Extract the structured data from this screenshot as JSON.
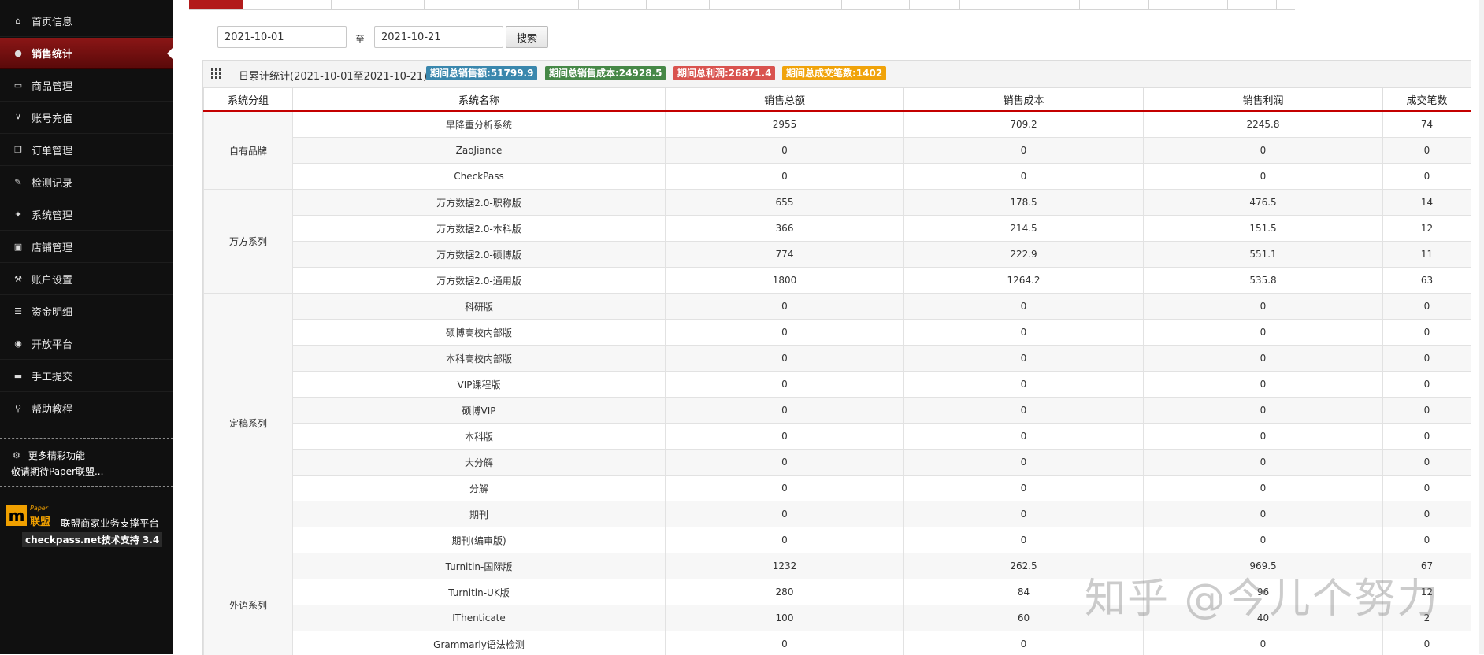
{
  "sidebar": {
    "items": [
      {
        "icon": "home-icon",
        "glyph": "⌂",
        "label": "首页信息"
      },
      {
        "icon": "user-icon",
        "glyph": "●",
        "label": "销售统计",
        "active": true
      },
      {
        "icon": "credit-card-icon",
        "glyph": "▭",
        "label": "商品管理"
      },
      {
        "icon": "cart-icon",
        "glyph": "⊻",
        "label": "账号充值"
      },
      {
        "icon": "copy-icon",
        "glyph": "❐",
        "label": "订单管理"
      },
      {
        "icon": "edit-icon",
        "glyph": "✎",
        "label": "检测记录"
      },
      {
        "icon": "wrench-icon",
        "glyph": "✦",
        "label": "系统管理"
      },
      {
        "icon": "truck-icon",
        "glyph": "▣",
        "label": "店铺管理"
      },
      {
        "icon": "hammer-icon",
        "glyph": "⚒",
        "label": "账户设置"
      },
      {
        "icon": "list-icon",
        "glyph": "☰",
        "label": "资金明细"
      },
      {
        "icon": "globe-icon",
        "glyph": "◉",
        "label": "开放平台"
      },
      {
        "icon": "folder-icon",
        "glyph": "▬",
        "label": "手工提交"
      },
      {
        "icon": "search-icon",
        "glyph": "⚲",
        "label": "帮助教程"
      }
    ],
    "more": {
      "line1": "更多精彩功能",
      "line2": "敬请期待Paper联盟..."
    },
    "brand": {
      "logo_m": "m",
      "logo_paper": "Paper",
      "logo_lm": "联盟",
      "title": "联盟商家业务支撑平台",
      "sub": "checkpass.net技术支持 3.4"
    }
  },
  "search": {
    "start_date": "2021-10-01",
    "to_label": "至",
    "end_date": "2021-10-21",
    "button": "搜索"
  },
  "stats": {
    "title": "日累计统计(2021-10-01至2021-10-21)",
    "badges": [
      {
        "text": "期间总销售额:51799.9",
        "color": "#3a87ad"
      },
      {
        "text": "期间总销售成本:24928.5",
        "color": "#468847"
      },
      {
        "text": "期间总利润:26871.4",
        "color": "#d9534f"
      },
      {
        "text": "期间总成交笔数:1402",
        "color": "#f0a30a"
      }
    ]
  },
  "table": {
    "headers": [
      "系统分组",
      "系统名称",
      "销售总额",
      "销售成本",
      "销售利润",
      "成交笔数"
    ],
    "groups": [
      {
        "name": "自有品牌",
        "rows": [
          [
            "早降重分析系统",
            "2955",
            "709.2",
            "2245.8",
            "74"
          ],
          [
            "ZaoJiance",
            "0",
            "0",
            "0",
            "0"
          ],
          [
            "CheckPass",
            "0",
            "0",
            "0",
            "0"
          ]
        ]
      },
      {
        "name": "万方系列",
        "rows": [
          [
            "万方数据2.0-职称版",
            "655",
            "178.5",
            "476.5",
            "14"
          ],
          [
            "万方数据2.0-本科版",
            "366",
            "214.5",
            "151.5",
            "12"
          ],
          [
            "万方数据2.0-硕博版",
            "774",
            "222.9",
            "551.1",
            "11"
          ],
          [
            "万方数据2.0-通用版",
            "1800",
            "1264.2",
            "535.8",
            "63"
          ]
        ]
      },
      {
        "name": "定稿系列",
        "rows": [
          [
            "科研版",
            "0",
            "0",
            "0",
            "0"
          ],
          [
            "硕博高校内部版",
            "0",
            "0",
            "0",
            "0"
          ],
          [
            "本科高校内部版",
            "0",
            "0",
            "0",
            "0"
          ],
          [
            "VIP课程版",
            "0",
            "0",
            "0",
            "0"
          ],
          [
            "硕博VIP",
            "0",
            "0",
            "0",
            "0"
          ],
          [
            "本科版",
            "0",
            "0",
            "0",
            "0"
          ],
          [
            "大分解",
            "0",
            "0",
            "0",
            "0"
          ],
          [
            "分解",
            "0",
            "0",
            "0",
            "0"
          ],
          [
            "期刊",
            "0",
            "0",
            "0",
            "0"
          ],
          [
            "期刊(编审版)",
            "0",
            "0",
            "0",
            "0"
          ]
        ]
      },
      {
        "name": "外语系列",
        "rows": [
          [
            "Turnitin-国际版",
            "1232",
            "262.5",
            "969.5",
            "67"
          ],
          [
            "Turnitin-UK版",
            "280",
            "84",
            "96",
            "12"
          ],
          [
            "IThenticate",
            "100",
            "60",
            "40",
            "2"
          ],
          [
            "Grammarly语法检测",
            "0",
            "0",
            "0",
            "0"
          ]
        ]
      }
    ]
  },
  "watermark": "知乎 @今儿个努力"
}
